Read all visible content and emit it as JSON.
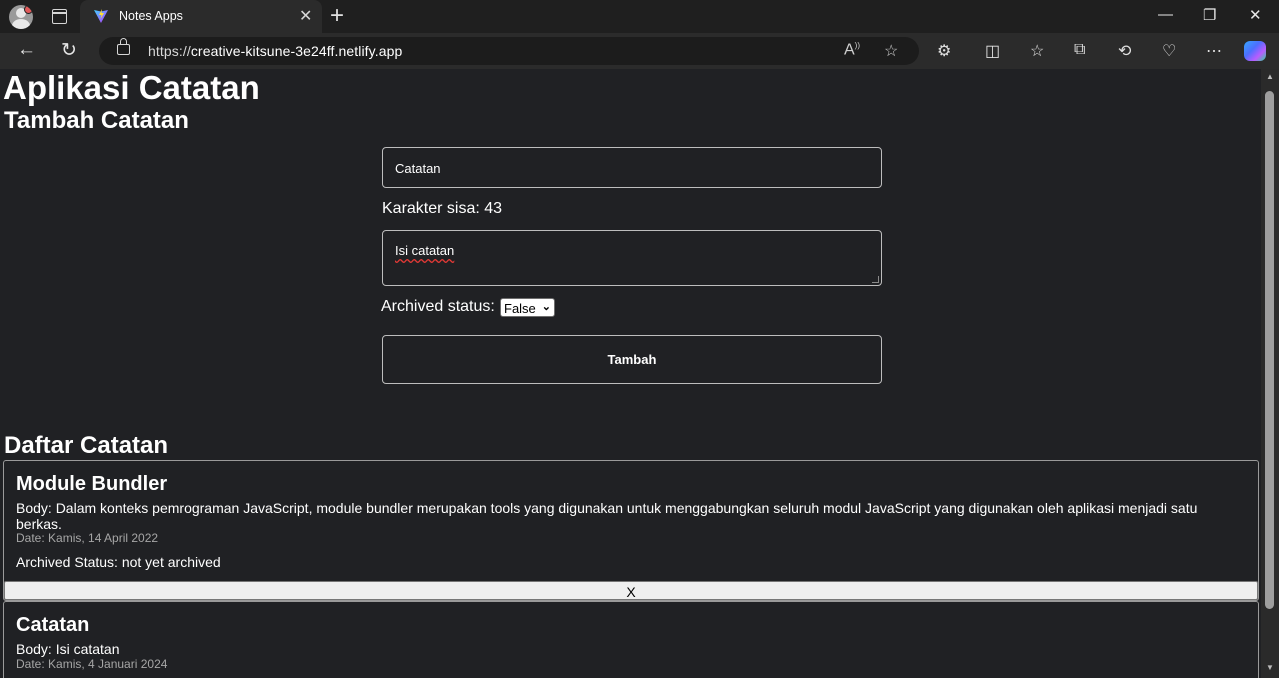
{
  "browser": {
    "tab_title": "Notes Apps",
    "url_prefix": "https://",
    "url_host": "creative-kitsune-3e24ff.netlify.app",
    "new_tab_symbol": "+",
    "close_symbol": "✕"
  },
  "app": {
    "title": "Aplikasi Catatan",
    "form_title": "Tambah Catatan",
    "title_input_value": "Catatan",
    "char_count_label": "Karakter sisa: 43",
    "body_input_value": "Isi catatan",
    "archived_label": "Archived status:",
    "archived_selected": "False",
    "submit_label": "Tambah",
    "list_title": "Daftar Catatan"
  },
  "notes": [
    {
      "title": "Module Bundler",
      "body": "Body: Dalam konteks pemrograman JavaScript, module bundler merupakan tools yang digunakan untuk menggabungkan seluruh modul JavaScript yang digunakan oleh aplikasi menjadi satu berkas.",
      "date": "Date: Kamis, 14 April 2022",
      "status": "Archived Status: not yet archived",
      "delete_label": "X"
    },
    {
      "title": "Catatan",
      "body": "Body: Isi catatan",
      "date": "Date: Kamis, 4 Januari 2024"
    }
  ],
  "colors": {
    "page_bg": "#202124",
    "chrome_bg": "#1f1f1f",
    "toolbar_bg": "#2b2b2b",
    "border": "#bdbdbd"
  }
}
